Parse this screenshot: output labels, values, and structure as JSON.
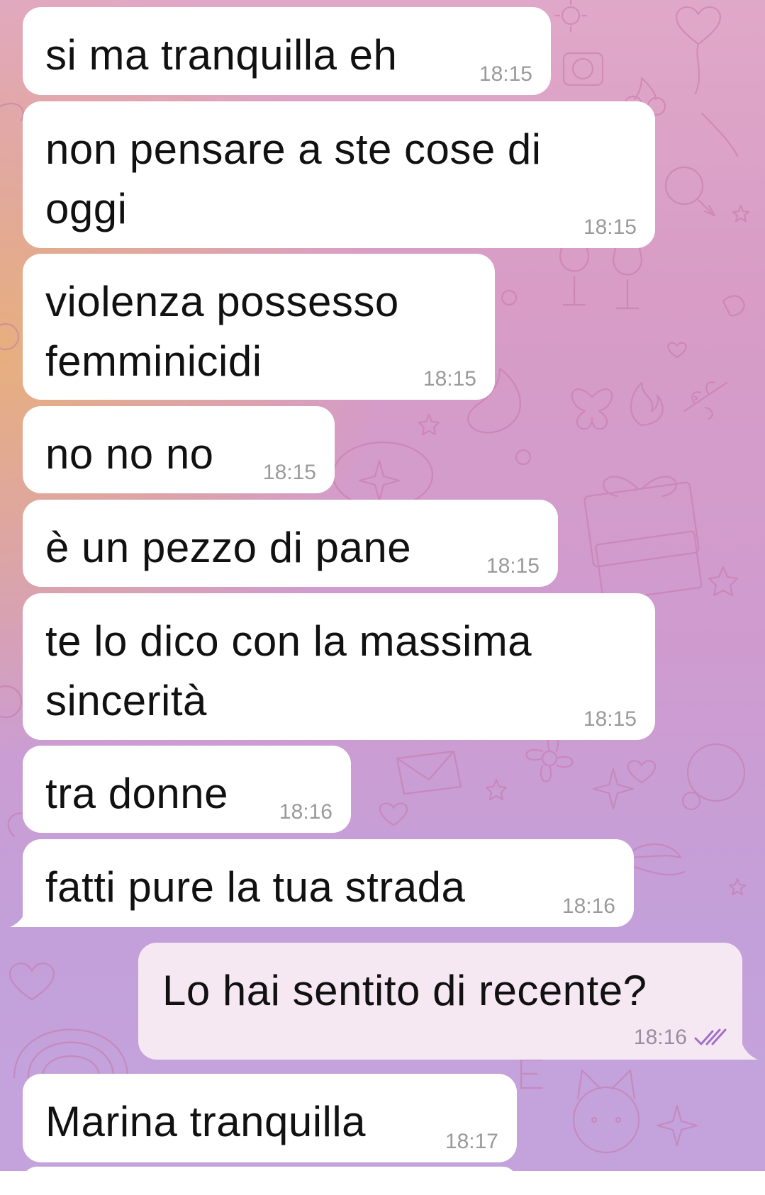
{
  "messages": [
    {
      "direction": "incoming",
      "text": "si ma tranquilla eh",
      "time": "18:15"
    },
    {
      "direction": "incoming",
      "text": "non pensare a ste cose di\noggi",
      "time": "18:15"
    },
    {
      "direction": "incoming",
      "text": "violenza possesso\nfemminicidi",
      "time": "18:15"
    },
    {
      "direction": "incoming",
      "text": "no no no",
      "time": "18:15"
    },
    {
      "direction": "incoming",
      "text": "è un pezzo di pane",
      "time": "18:15"
    },
    {
      "direction": "incoming",
      "text": "te lo dico con la massima\nsincerità",
      "time": "18:15"
    },
    {
      "direction": "incoming",
      "text": "tra donne",
      "time": "18:16"
    },
    {
      "direction": "incoming",
      "text": "fatti pure la tua strada",
      "time": "18:16"
    },
    {
      "direction": "outgoing",
      "text": "Lo hai sentito di recente?",
      "time": "18:16",
      "status": "read-double-check-icon"
    },
    {
      "direction": "incoming",
      "text": "Marina tranquilla",
      "time": "18:17"
    }
  ],
  "colors": {
    "incoming_bubble": "#ffffff",
    "outgoing_bubble": "#f5e8f2",
    "check_marks": "#a070c8"
  }
}
